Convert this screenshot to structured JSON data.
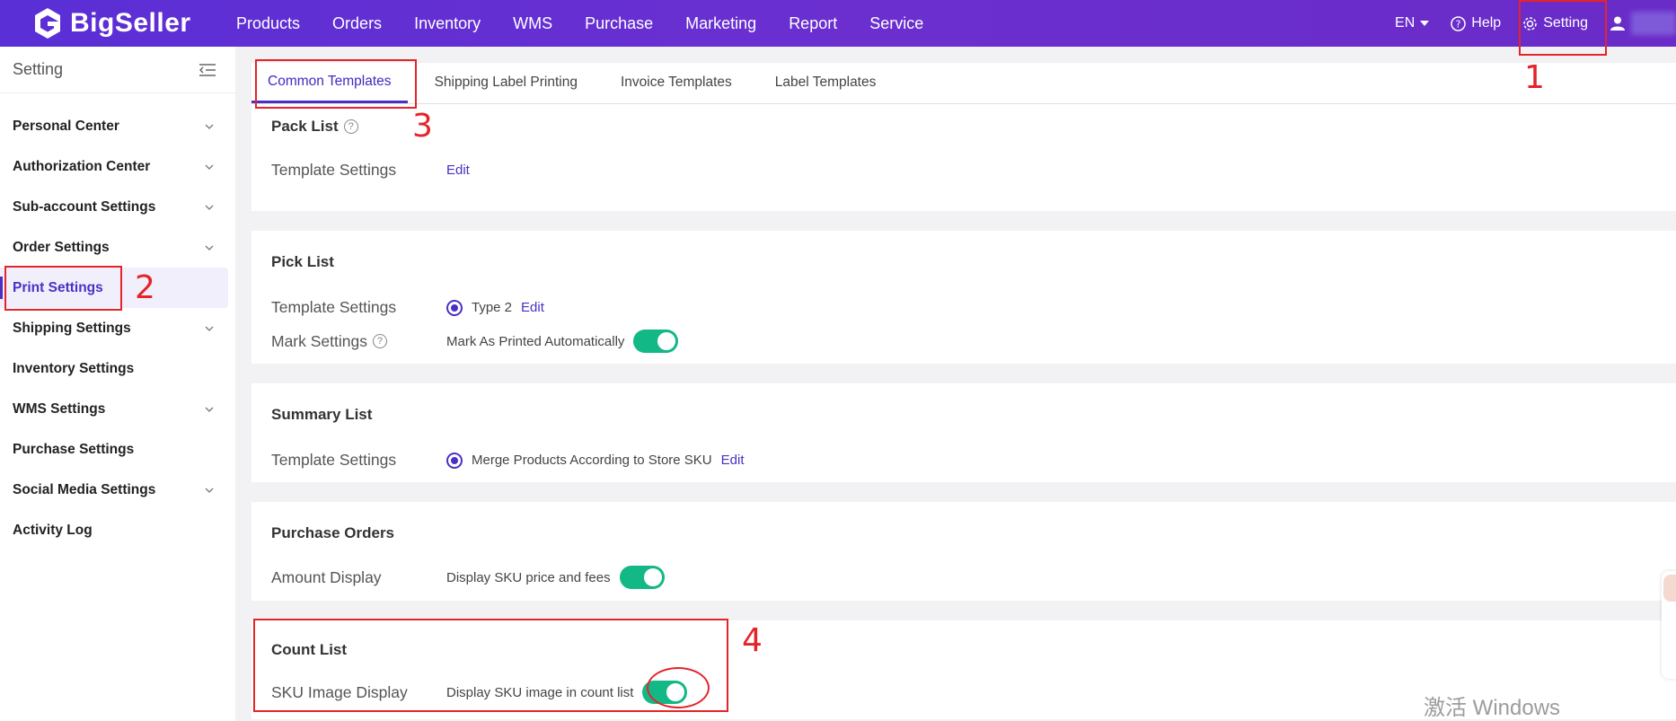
{
  "colors": {
    "brand": "#5a2fd6",
    "accent": "#4b2fc4",
    "toggle_on": "#12b886",
    "annotation": "#e3242b"
  },
  "topbar": {
    "logo": "BigSeller",
    "nav": [
      "Products",
      "Orders",
      "Inventory",
      "WMS",
      "Purchase",
      "Marketing",
      "Report",
      "Service"
    ],
    "lang": "EN",
    "help": "Help",
    "setting": "Setting"
  },
  "sidebar": {
    "title": "Setting",
    "items": [
      {
        "label": "Personal Center",
        "chevron": true
      },
      {
        "label": "Authorization Center",
        "chevron": true
      },
      {
        "label": "Sub-account Settings",
        "chevron": true
      },
      {
        "label": "Order Settings",
        "chevron": true
      },
      {
        "label": "Print Settings",
        "chevron": false,
        "active": true
      },
      {
        "label": "Shipping Settings",
        "chevron": true
      },
      {
        "label": "Inventory Settings",
        "chevron": false
      },
      {
        "label": "WMS Settings",
        "chevron": true
      },
      {
        "label": "Purchase Settings",
        "chevron": false
      },
      {
        "label": "Social Media Settings",
        "chevron": true
      },
      {
        "label": "Activity Log",
        "chevron": false
      }
    ]
  },
  "tabs": [
    "Common Templates",
    "Shipping Label Printing",
    "Invoice Templates",
    "Label Templates"
  ],
  "sections": {
    "pack_list": {
      "title": "Pack List",
      "template_label": "Template Settings",
      "edit": "Edit"
    },
    "pick_list": {
      "title": "Pick List",
      "template_label": "Template Settings",
      "template_value": "Type 2",
      "edit": "Edit",
      "mark_label": "Mark Settings",
      "mark_value": "Mark As Printed Automatically"
    },
    "summary_list": {
      "title": "Summary List",
      "template_label": "Template Settings",
      "template_value": "Merge Products According to Store SKU",
      "edit": "Edit"
    },
    "purchase_orders": {
      "title": "Purchase Orders",
      "amount_label": "Amount Display",
      "amount_value": "Display SKU price and fees"
    },
    "count_list": {
      "title": "Count List",
      "image_label": "SKU Image Display",
      "image_value": "Display SKU image in count list"
    }
  },
  "annotations": [
    "1",
    "2",
    "3",
    "4"
  ],
  "watermark": "激活 Windows"
}
